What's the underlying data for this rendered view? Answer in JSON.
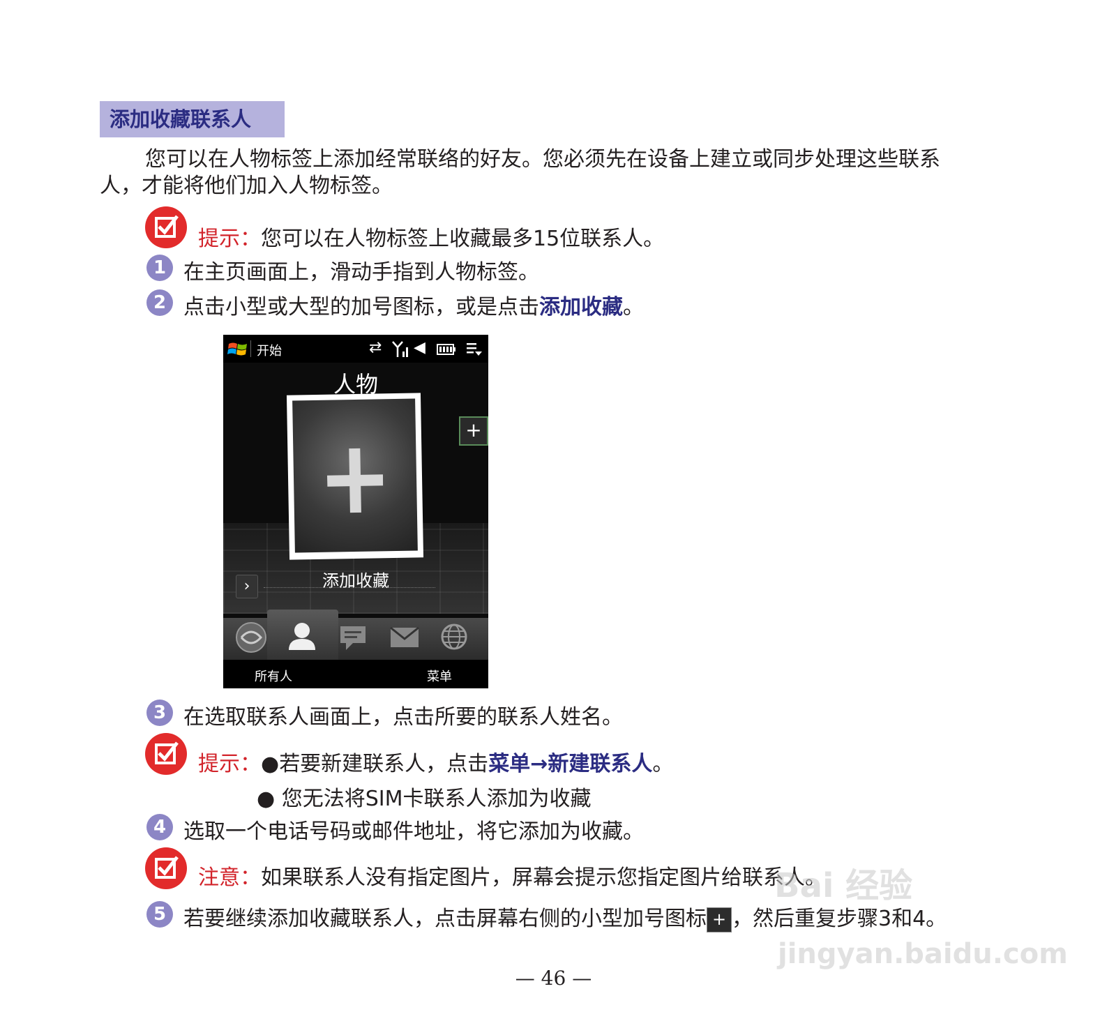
{
  "section_title": "添加收藏联系人",
  "intro_line1": "您可以在人物标签上添加经常联络的好友。您必须先在设备上建立或同步处理这些联系",
  "intro_line2": "人，才能将他们加入人物标签。",
  "tip1": {
    "label": "提示：",
    "text": "您可以在人物标签上收藏最多15位联系人。"
  },
  "steps": [
    {
      "num": "1",
      "text": "在主页画面上，滑动手指到人物标签。"
    },
    {
      "num": "2",
      "text": "点击小型或大型的加号图标，或是点击",
      "highlight": "添加收藏",
      "end": "。"
    },
    {
      "num": "3",
      "text": "在选取联系人画面上，点击所要的联系人姓名。"
    },
    {
      "num": "4",
      "text": "选取一个电话号码或邮件地址，将它添加为收藏。"
    },
    {
      "num": "5",
      "text": "若要继续添加收藏联系人，点击屏幕右侧的小型加号图标",
      "text_after": "，然后重复步骤3和4。"
    }
  ],
  "tip2": {
    "label": "提示：",
    "bullet1_pre": "若要新建联系人，点击",
    "bullet1_menu": "菜单",
    "bullet1_arrow": "→",
    "bullet1_item": "新建联系人",
    "bullet1_end": "。",
    "bullet2": "您无法将SIM卡联系人添加为收藏"
  },
  "note": {
    "label": "注意：",
    "text": "如果联系人没有指定图片，屏幕会提示您指定图片给联系人。"
  },
  "phone": {
    "start": "开始",
    "title": "人物",
    "card_label": "添加收藏",
    "softkey_left": "所有人",
    "softkey_right": "菜单"
  },
  "page_number": "— 46 —",
  "watermark_top": "Bai 经验",
  "watermark_bottom": "jingyan.baidu.com",
  "colors": {
    "accent": "#2b2c82",
    "tip_red": "#d2232a",
    "title_bg": "#b5b2dd",
    "step_circle": "#8c86c5"
  }
}
